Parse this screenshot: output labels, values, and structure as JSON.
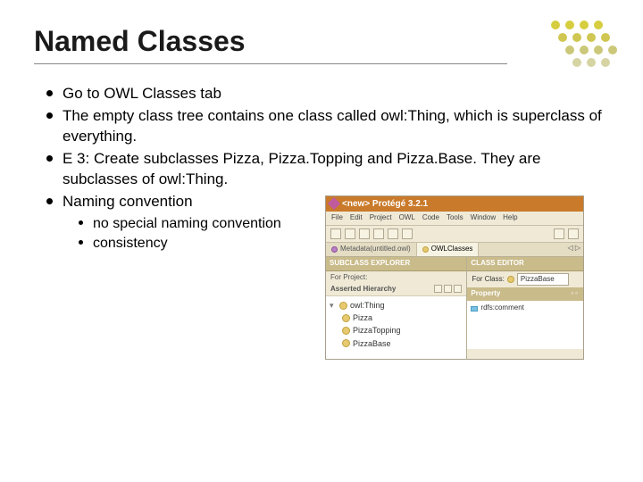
{
  "title": "Named Classes",
  "bullets": {
    "b1": "Go to OWL Classes tab",
    "b2": "The empty class tree contains one class called owl:Thing, which is superclass of everything.",
    "b3": "E 3: Create subclasses Pizza, Pizza.Topping and Pizza.Base. They are subclasses of owl:Thing.",
    "b4": "Naming convention",
    "b4s1": "no special naming convention",
    "b4s2": "consistency"
  },
  "protege": {
    "window_title": "<new>  Protégé 3.2.1",
    "menubar": [
      "File",
      "Edit",
      "Project",
      "OWL",
      "Code",
      "Tools",
      "Window",
      "Help"
    ],
    "tabs": {
      "t1": "Metadata(untitled.owl)",
      "t2": "OWLClasses"
    },
    "tab_nav": "◁ ▷",
    "left": {
      "header": "SUBCLASS EXPLORER",
      "for_project": "For Project:",
      "hier_label": "Asserted Hierarchy",
      "tree": {
        "root": "owl:Thing",
        "c1": "Pizza",
        "c2": "PizzaTopping",
        "c3": "PizzaBase"
      }
    },
    "right": {
      "header": "CLASS EDITOR",
      "for_class": "For Class:",
      "class_value": "PizzaBase",
      "prop_header": "Property",
      "prop1": "rdfs:comment"
    }
  }
}
